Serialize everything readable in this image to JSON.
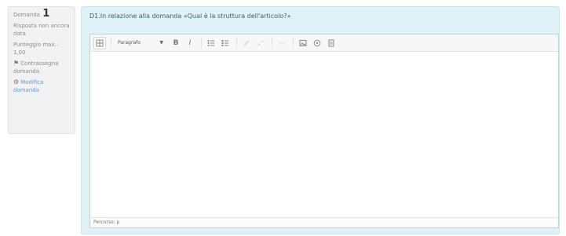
{
  "question_info": {
    "question_label": "Domanda",
    "question_number": "1",
    "status": "Risposta non ancora data",
    "marks_label": "Punteggio max.:",
    "marks_value": "1,00",
    "flag_icon": "flag-icon",
    "flag_label": "Contrassegna domanda",
    "edit_icon": "gear-icon",
    "edit_label": "Modifica domanda"
  },
  "question": {
    "text": "D1.In relazione alla domanda «Qual è la struttura dell'articolo?»"
  },
  "editor": {
    "toolbar": {
      "toggle_icon": "toolbar-toggle-icon",
      "format_value": "Paragrafo",
      "bold_label": "B",
      "italic_label": "I",
      "unordered_list_icon": "unordered-list-icon",
      "ordered_list_icon": "ordered-list-icon",
      "link_icon": "link-icon",
      "unlink_icon": "unlink-icon",
      "image_icon": "image-icon",
      "media_icon": "media-icon",
      "manage_files_icon": "manage-files-icon"
    },
    "content": "",
    "path_label": "Percorso: p"
  },
  "colors": {
    "formulation_bg": "#def2f8",
    "info_bg": "#f2f2f2",
    "link": "#5b9bd5"
  }
}
